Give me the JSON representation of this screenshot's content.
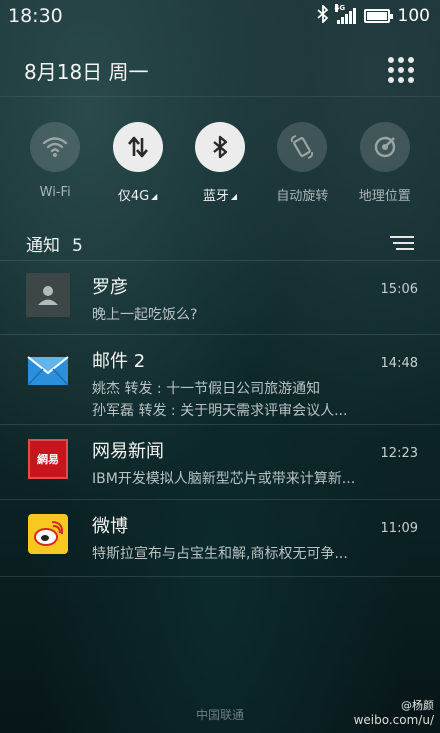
{
  "status_bar": {
    "time": "18:30",
    "network_label": "4G",
    "battery": "100"
  },
  "header": {
    "date": "8月18日 周一"
  },
  "quick_toggles": [
    {
      "label": "Wi-Fi",
      "icon": "wifi-icon",
      "on": false
    },
    {
      "label": "仅4G",
      "icon": "data-arrows-icon",
      "on": true
    },
    {
      "label": "蓝牙",
      "icon": "bluetooth-icon",
      "on": true
    },
    {
      "label": "自动旋转",
      "icon": "rotate-icon",
      "on": false
    },
    {
      "label": "地理位置",
      "icon": "location-icon",
      "on": false
    }
  ],
  "notifications_header": {
    "title": "通知",
    "count": "5"
  },
  "notifications": [
    {
      "app": "contact",
      "title": "罗彦",
      "time": "15:06",
      "lines": [
        "晚上一起吃饭么?"
      ]
    },
    {
      "app": "mail",
      "title": "邮件 2",
      "time": "14:48",
      "lines": [
        "姚杰   转发 : 十一节假日公司旅游通知",
        "孙军磊   转发 : 关于明天需求评审会议人..."
      ]
    },
    {
      "app": "netease-news",
      "title": "网易新闻",
      "time": "12:23",
      "lines": [
        "IBM开发模拟人脑新型芯片或带来计算新..."
      ]
    },
    {
      "app": "weibo",
      "title": "微博",
      "time": "11:09",
      "lines": [
        "特斯拉宣布与占宝生和解,商标权无可争..."
      ]
    }
  ],
  "netease_icon_text": "網易",
  "carrier": "中国联通",
  "watermark": {
    "top": "@杨颜",
    "bottom": "weibo.com/u/"
  },
  "colors": {
    "mail_blue": "#2b8fdc",
    "netease_red": "#c4161c",
    "weibo_yellow": "#f7c820"
  }
}
